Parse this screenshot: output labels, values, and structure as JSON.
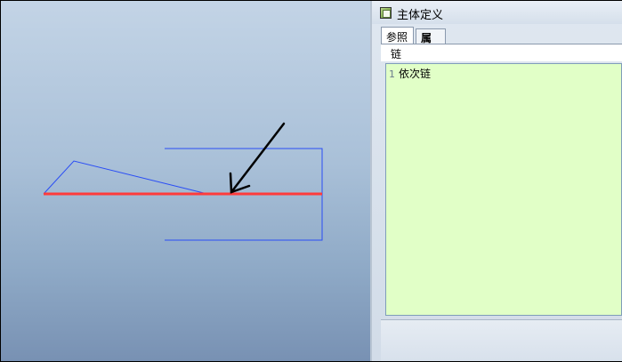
{
  "panel": {
    "title": "主体定义",
    "tabs": [
      {
        "label": "参照",
        "active": true
      },
      {
        "label": "属性",
        "active": false
      }
    ],
    "refs_header": "链",
    "refs": [
      {
        "index": "1",
        "label": "依次链"
      }
    ]
  },
  "colors": {
    "selected_chain": "#ff3b3b",
    "geometry": "#2a4df5",
    "arrow": "#000000",
    "refs_list_bg": "#e1ffc7"
  }
}
